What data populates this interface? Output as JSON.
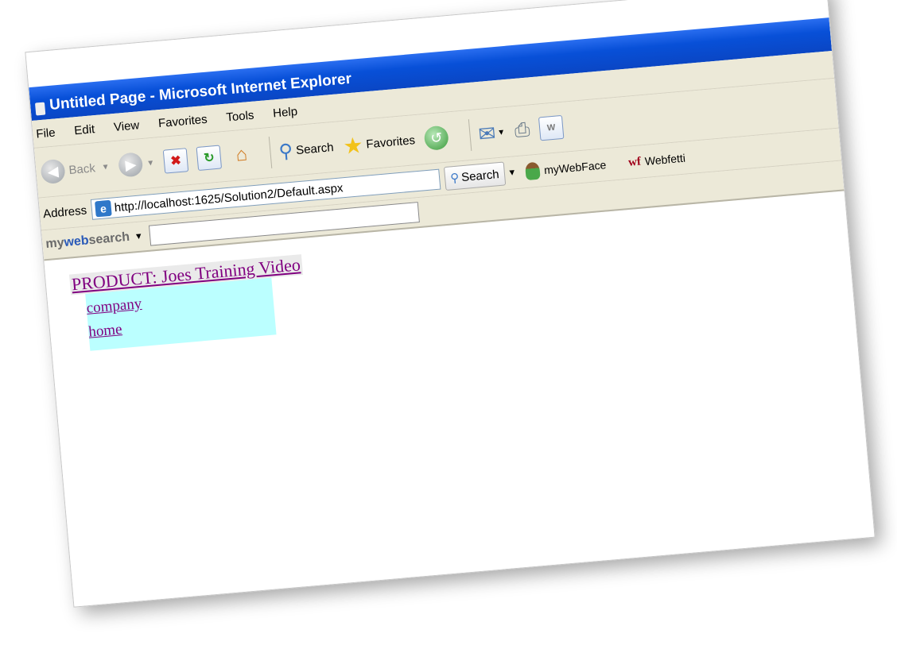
{
  "window": {
    "title": "Untitled Page - Microsoft Internet Explorer"
  },
  "menubar": {
    "items": [
      "File",
      "Edit",
      "View",
      "Favorites",
      "Tools",
      "Help"
    ]
  },
  "toolbar": {
    "back_label": "Back",
    "search_label": "Search",
    "favorites_label": "Favorites"
  },
  "addressbar": {
    "label": "Address",
    "url": "http://localhost:1625/Solution2/Default.aspx",
    "search_label": "Search",
    "mywebface_label": "myWebFace",
    "webfetti_label": "Webfetti",
    "webfetti_icon_text": "wf"
  },
  "mywebsearch": {
    "brand_prefix": "my",
    "brand_bold": "web",
    "brand_suffix": "search",
    "query": ""
  },
  "page": {
    "product_link": "PRODUCT: Joes Training Video",
    "submenu": [
      "company",
      "home"
    ],
    "submenu_bg": "#bbffff",
    "link_color": "#800080"
  }
}
